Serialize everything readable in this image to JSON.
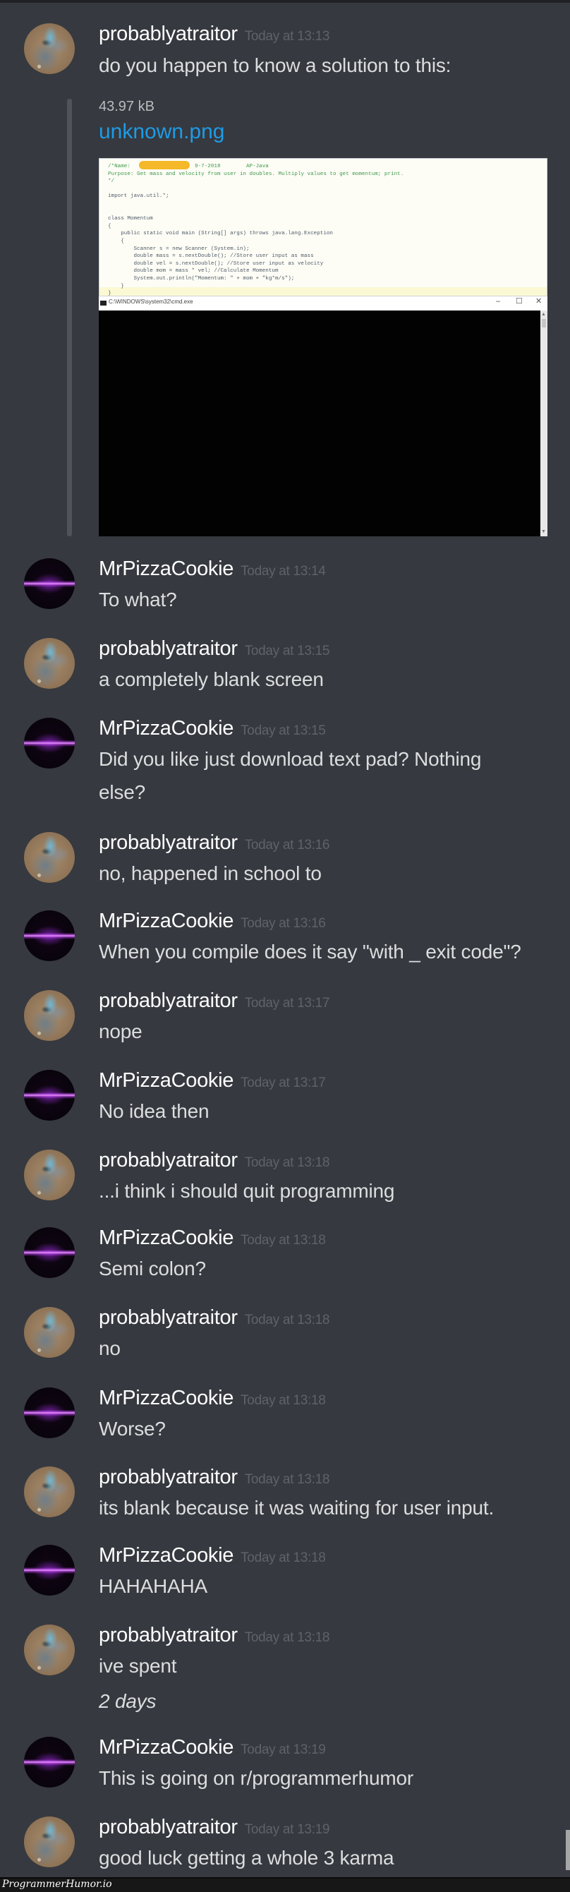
{
  "users": {
    "traitor": "probablyatraitor",
    "pizza": "MrPizzaCookie"
  },
  "messages": [
    {
      "author": "probablyatraitor",
      "timestamp": "Today at 13:13",
      "lines": [
        "do you happen to know a solution to this:"
      ]
    },
    {
      "author": "MrPizzaCookie",
      "timestamp": "Today at 13:14",
      "lines": [
        "To what?"
      ]
    },
    {
      "author": "probablyatraitor",
      "timestamp": "Today at 13:15",
      "lines": [
        "a completely blank screen"
      ]
    },
    {
      "author": "MrPizzaCookie",
      "timestamp": "Today at 13:15",
      "lines": [
        "Did you like just download text pad? Nothing",
        "else?"
      ]
    },
    {
      "author": "probablyatraitor",
      "timestamp": "Today at 13:16",
      "lines": [
        "no, happened in school to"
      ]
    },
    {
      "author": "MrPizzaCookie",
      "timestamp": "Today at 13:16",
      "lines": [
        "When you compile does it say \"with _ exit code\"?"
      ]
    },
    {
      "author": "probablyatraitor",
      "timestamp": "Today at 13:17",
      "lines": [
        "nope"
      ]
    },
    {
      "author": "MrPizzaCookie",
      "timestamp": "Today at 13:17",
      "lines": [
        "No idea then"
      ]
    },
    {
      "author": "probablyatraitor",
      "timestamp": "Today at 13:18",
      "lines": [
        "...i think i should quit programming"
      ]
    },
    {
      "author": "MrPizzaCookie",
      "timestamp": "Today at 13:18",
      "lines": [
        "Semi colon?"
      ]
    },
    {
      "author": "probablyatraitor",
      "timestamp": "Today at 13:18",
      "lines": [
        "no"
      ]
    },
    {
      "author": "MrPizzaCookie",
      "timestamp": "Today at 13:18",
      "lines": [
        "Worse?"
      ]
    },
    {
      "author": "probablyatraitor",
      "timestamp": "Today at 13:18",
      "lines": [
        "its blank because it was waiting for user input."
      ]
    },
    {
      "author": "MrPizzaCookie",
      "timestamp": "Today at 13:18",
      "lines": [
        "HAHAHAHA"
      ]
    },
    {
      "author": "probablyatraitor",
      "timestamp": "Today at 13:18",
      "lines": [
        "ive spent"
      ],
      "extra_italic": "2 days"
    },
    {
      "author": "MrPizzaCookie",
      "timestamp": "Today at 13:19",
      "lines": [
        "This is going on r/programmerhumor"
      ]
    },
    {
      "author": "probablyatraitor",
      "timestamp": "Today at 13:19",
      "lines": [
        "good luck getting a whole 3 karma"
      ]
    }
  ],
  "attachment": {
    "size": "43.97 kB",
    "filename": "unknown.png",
    "screenshot": {
      "code_lines": [
        "/*Name:                    9-7-2018        AP-Java",
        "Purpose: Get mass and velocity from user in doubles. Multiply values to get momentum; print.",
        "*/",
        "",
        "import java.util.*;",
        "",
        "",
        "class Momentum",
        "{",
        "    public static void main (String[] args) throws java.lang.Exception",
        "    {",
        "        Scanner s = new Scanner (System.in);",
        "        double mass = s.nextDouble(); //Store user input as mass",
        "        double vel = s.nextDouble(); //Store user input as velocity",
        "        double mom = mass * vel; //Calculate Momentum",
        "        System.out.println(\"Momentum: \" + mom + \"kg*m/s\");",
        "    }",
        "}"
      ],
      "terminal_title": "C:\\WINDOWS\\system32\\cmd.exe",
      "window_buttons": {
        "minimize": "–",
        "maximize": "☐",
        "close": "✕"
      }
    }
  },
  "footer": {
    "watermark": "ProgrammerHumor.io"
  },
  "colors": {
    "background": "#36393f",
    "username": "#ffffff",
    "timestamp": "#5f6368",
    "message_text": "#dcddde",
    "link": "#1e9be6"
  }
}
